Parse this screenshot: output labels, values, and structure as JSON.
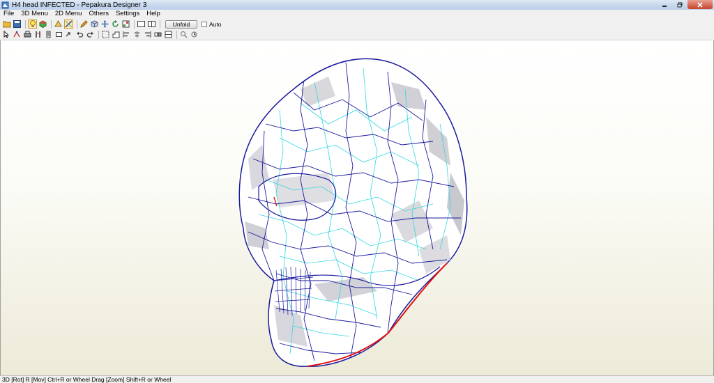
{
  "window": {
    "title": "H4  head INFECTED - Pepakura Designer 3"
  },
  "menu": [
    "File",
    "3D Menu",
    "2D Menu",
    "Others",
    "Settings",
    "Help"
  ],
  "toolbar": {
    "unfold_label": "Unfold",
    "auto_label": "Auto",
    "auto_checked": false
  },
  "icons_row1": [
    "open-icon",
    "save-icon",
    "light-icon",
    "texture-icon",
    "face-icon",
    "edge-icon",
    "pencil-icon",
    "cube-icon",
    "move-icon",
    "rotate-icon",
    "layout-icon",
    "view-single-icon",
    "view-split-icon"
  ],
  "icons_row2": [
    "select-icon",
    "join-icon",
    "print-icon",
    "cut-icon",
    "flap-icon",
    "grid-icon",
    "arrow-icon",
    "undo-icon",
    "redo-icon",
    "text-icon",
    "image-icon",
    "align-left-icon",
    "align-center-icon",
    "align-right-icon",
    "distribute-icon",
    "snap-icon",
    "zoom-icon",
    "rotate-view-icon"
  ],
  "status": {
    "text": "3D [Rot] R [Mov] Ctrl+R or Wheel Drag [Zoom] Shift+R or Wheel"
  },
  "colors": {
    "valley_fold": "#30d8e0",
    "mountain_fold": "#1a1a9e",
    "cut_edge": "#e01010"
  }
}
